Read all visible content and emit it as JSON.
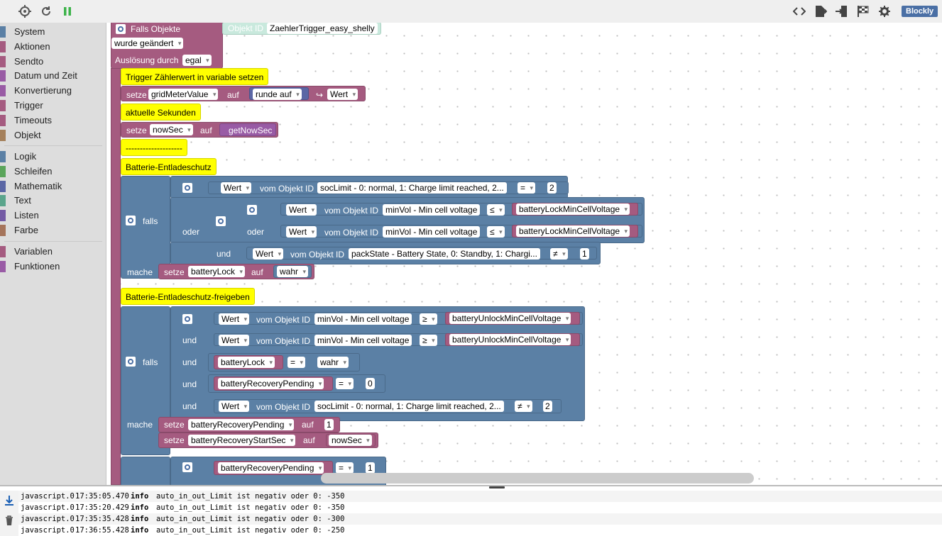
{
  "toolbar": {
    "left_icons": [
      "crosshair-icon",
      "reload-icon",
      "pause-icon"
    ],
    "right_icons": [
      "code-icon",
      "export-icon",
      "import-icon",
      "flag-icon",
      "settings-icon"
    ],
    "mode_badge": "Blockly"
  },
  "sidebar": {
    "groups": [
      [
        {
          "label": "System",
          "color": "#5b80a5"
        },
        {
          "label": "Aktionen",
          "color": "#a55b80"
        },
        {
          "label": "Sendto",
          "color": "#a55b80"
        },
        {
          "label": "Datum und Zeit",
          "color": "#995ba5"
        },
        {
          "label": "Konvertierung",
          "color": "#995ba5"
        },
        {
          "label": "Trigger",
          "color": "#a55b80"
        },
        {
          "label": "Timeouts",
          "color": "#a55b80"
        },
        {
          "label": "Objekt",
          "color": "#a5805b"
        }
      ],
      [
        {
          "label": "Logik",
          "color": "#5b80a5"
        },
        {
          "label": "Schleifen",
          "color": "#5ba55b"
        },
        {
          "label": "Mathematik",
          "color": "#5b67a5"
        },
        {
          "label": "Text",
          "color": "#5ba58c"
        },
        {
          "label": "Listen",
          "color": "#745ba5"
        },
        {
          "label": "Farbe",
          "color": "#a5745b"
        }
      ],
      [
        {
          "label": "Variablen",
          "color": "#a55b80"
        },
        {
          "label": "Funktionen",
          "color": "#995ba5"
        }
      ]
    ]
  },
  "workspace": {
    "event": {
      "title": "Falls Objekte",
      "objid_label": "Objekt ID",
      "objid_value": "ZaehlerTrigger_easy_shelly",
      "changed": "wurde geändert",
      "trigger_label": "Auslösung durch",
      "trigger_value": "egal"
    },
    "comment1": "Trigger Zählerwert in variable setzen",
    "set1": {
      "setze": "setze",
      "var": "gridMeterValue",
      "auf": "auf",
      "round": "runde auf",
      "wert": "Wert"
    },
    "comment2": "aktuelle Sekunden",
    "set2": {
      "setze": "setze",
      "var": "nowSec",
      "auf": "auf",
      "func": "getNowSec"
    },
    "comment3": "--------------------",
    "comment4": "Batterie-Entladeschutz",
    "if1": {
      "falls": "falls",
      "oder": "oder",
      "und": "und",
      "mache": "mache",
      "row1": {
        "wert": "Wert",
        "vom": "vom Objekt ID",
        "obj": "socLimit - 0: normal, 1: Charge limit reached, 2...",
        "op": "=",
        "val": "2"
      },
      "row2": {
        "wert": "Wert",
        "vom": "vom Objekt ID",
        "obj": "minVol - Min cell voltage",
        "op": "≤",
        "var": "batteryLockMinCellVoltage"
      },
      "row3": {
        "wert": "Wert",
        "vom": "vom Objekt ID",
        "obj": "minVol - Min cell voltage",
        "op": "≤",
        "var": "batteryLockMinCellVoltage"
      },
      "row4": {
        "wert": "Wert",
        "vom": "vom Objekt ID",
        "obj": "packState - Battery State, 0: Standby, 1: Chargi...",
        "op": "≠",
        "val": "1"
      },
      "set": {
        "setze": "setze",
        "var": "batteryLock",
        "auf": "auf",
        "val": "wahr"
      }
    },
    "comment5": "Batterie-Entladeschutz-freigeben",
    "if2": {
      "falls": "falls",
      "und": "und",
      "mache": "mache",
      "row1": {
        "wert": "Wert",
        "vom": "vom Objekt ID",
        "obj": "minVol - Min cell voltage",
        "op": "≥",
        "var": "batteryUnlockMinCellVoltage"
      },
      "row2": {
        "wert": "Wert",
        "vom": "vom Objekt ID",
        "obj": "minVol - Min cell voltage",
        "op": "≥",
        "var": "batteryUnlockMinCellVoltage"
      },
      "row3": {
        "var": "batteryLock",
        "op": "=",
        "val": "wahr"
      },
      "row4": {
        "var": "batteryRecoveryPending",
        "op": "=",
        "val": "0"
      },
      "row5": {
        "wert": "Wert",
        "vom": "vom Objekt ID",
        "obj": "socLimit - 0: normal, 1: Charge limit reached, 2...",
        "op": "≠",
        "val": "2"
      },
      "set1": {
        "setze": "setze",
        "var": "batteryRecoveryPending",
        "auf": "auf",
        "val": "1"
      },
      "set2": {
        "setze": "setze",
        "var": "batteryRecoveryStartSec",
        "auf": "auf",
        "val": "nowSec"
      }
    },
    "if3": {
      "var": "batteryRecoveryPending",
      "op": "=",
      "val": "1"
    }
  },
  "log": [
    {
      "src": "javascript.0",
      "time": "17:35:05.470",
      "level": "info",
      "msg": "auto_in_out_Limit ist negativ oder 0: -350"
    },
    {
      "src": "javascript.0",
      "time": "17:35:20.429",
      "level": "info",
      "msg": "auto_in_out_Limit ist negativ oder 0: -350"
    },
    {
      "src": "javascript.0",
      "time": "17:35:35.428",
      "level": "info",
      "msg": "auto_in_out_Limit ist negativ oder 0: -300"
    },
    {
      "src": "javascript.0",
      "time": "17:36:55.428",
      "level": "info",
      "msg": "auto_in_out_Limit ist negativ oder 0: -250"
    }
  ]
}
